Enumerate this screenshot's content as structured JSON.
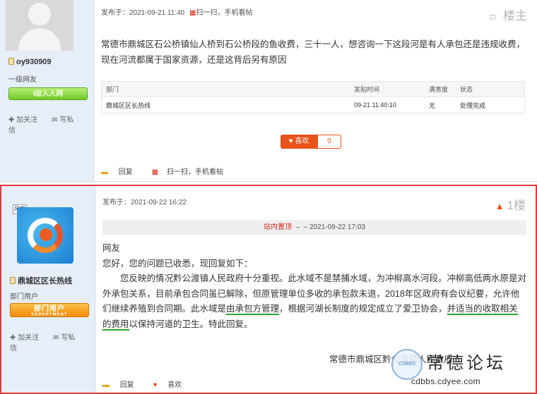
{
  "post1": {
    "user": {
      "name": "oy930909",
      "level": "一级网友",
      "badge": "I级人人网",
      "follow_label": "加关注",
      "message_label": "写私信"
    },
    "meta": {
      "posted": "发布于：2021-09-21 11:40",
      "scan": "扫一扫，手机看帖"
    },
    "floor": "楼主",
    "content": "常德市鼎城区石公桥镇仙人桥到石公桥段的鱼收费，三十一人，想咨询一下这段河是有人承包还是违规收费，现在河流都属于国家资源，还是这背后另有原因",
    "table": {
      "headers": [
        "部门",
        "发贴时间",
        "满意度",
        "状态"
      ],
      "row": [
        "鼎城区区长热线",
        "09-21 11:40:10",
        "无",
        "处理完成"
      ]
    },
    "like": {
      "label": "喜欢",
      "count": "0"
    },
    "actions": {
      "reply": "回复",
      "scan": "扫一扫，手机看帖"
    }
  },
  "post2": {
    "user": {
      "name": "鼎城区区长热线",
      "level": "部门用户",
      "badge": "部门用户",
      "badge_sub": "DEPARTMENT",
      "follow_label": "加关注",
      "message_label": "写私信",
      "tag_icon": "风字"
    },
    "meta": {
      "posted": "发布于：2021-09-22 16:22"
    },
    "floor": "1楼",
    "sysbar": {
      "label": "站内置顶",
      "sep": "–",
      "time": "– 2021-09-22 17:03"
    },
    "reply": {
      "greeting": "网友",
      "line1": "您好，您的问题已收悉，现回复如下：",
      "p1": "您反映的情况黔公渡镇人民政府十分重视。此水域不是禁捕水域，为冲柳高水河段。冲柳高低两水原是对外承包关系，目前承包合同虽已解除，但原管理单位多收的承包款未退，2018年区政府有会议纪要，允许他们继续养殖到合同期。此水域是",
      "u1": "由承包方管理",
      "p2": "，根据河湖长制度的规定成立了爱卫协会，",
      "u2": "并适当的",
      "u3": "收取相关的费用",
      "p3": "以保持河道的卫生。特此回复。"
    },
    "sign": "常德市鼎城区黔公渡镇人民政府",
    "actions": {
      "reply": "回复",
      "like": "喜欢"
    }
  },
  "watermark": {
    "text": "常德论坛",
    "url": "cdbbs.cdyee.com",
    "seal": "CDBBS"
  },
  "colors": {
    "accent_red": "#e03a3a",
    "like_orange": "#e8531b",
    "underline_green": "#2aa52a",
    "sidebar_bg": "#e6eef8"
  }
}
